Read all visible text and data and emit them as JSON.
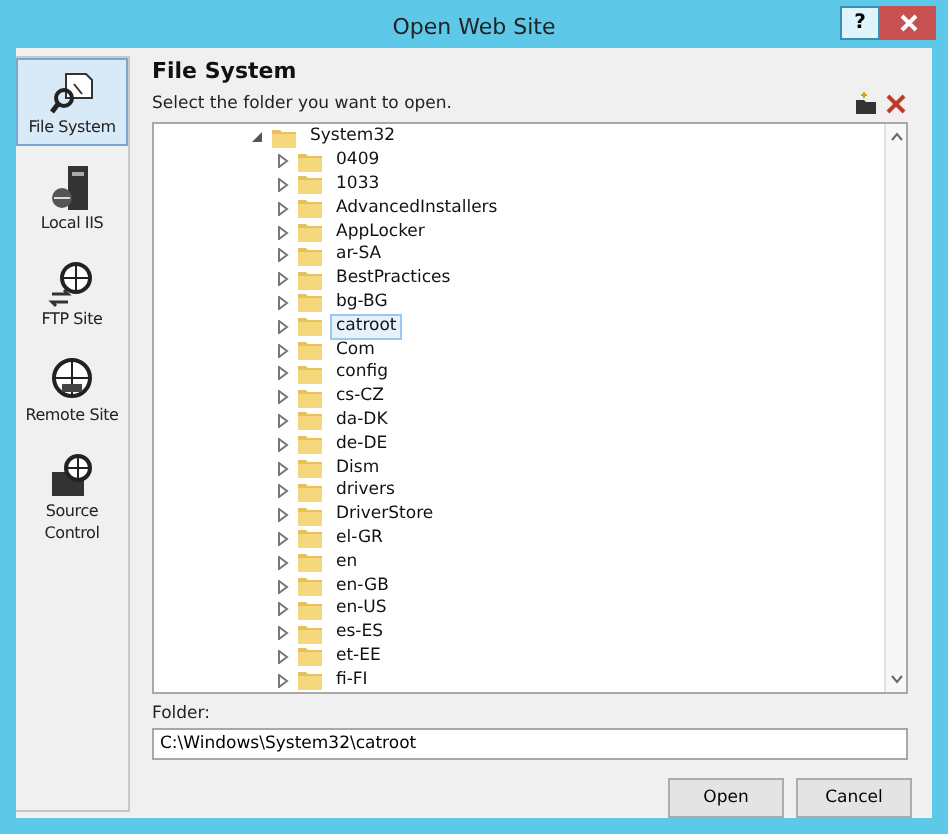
{
  "window": {
    "title": "Open Web Site",
    "help": "?"
  },
  "sidebar": {
    "items": [
      {
        "label": "File System",
        "kind": "filesystem",
        "selected": true
      },
      {
        "label": "Local IIS",
        "kind": "server",
        "selected": false
      },
      {
        "label": "FTP Site",
        "kind": "ftp",
        "selected": false
      },
      {
        "label": "Remote Site",
        "kind": "globe",
        "selected": false
      },
      {
        "label": "Source Control",
        "kind": "source",
        "selected": false
      }
    ]
  },
  "heading": "File System",
  "instruction": "Select the folder you want to open.",
  "tree": [
    {
      "label": "System32",
      "expanded": true,
      "selected": false,
      "children": [
        {
          "label": "0409",
          "expanded": false,
          "selected": false
        },
        {
          "label": "1033",
          "expanded": false,
          "selected": false
        },
        {
          "label": "AdvancedInstallers",
          "expanded": false,
          "selected": false
        },
        {
          "label": "AppLocker",
          "expanded": false,
          "selected": false
        },
        {
          "label": "ar-SA",
          "expanded": false,
          "selected": false
        },
        {
          "label": "BestPractices",
          "expanded": false,
          "selected": false
        },
        {
          "label": "bg-BG",
          "expanded": false,
          "selected": false
        },
        {
          "label": "catroot",
          "expanded": false,
          "selected": true
        },
        {
          "label": "Com",
          "expanded": false,
          "selected": false
        },
        {
          "label": "config",
          "expanded": false,
          "selected": false
        },
        {
          "label": "cs-CZ",
          "expanded": false,
          "selected": false
        },
        {
          "label": "da-DK",
          "expanded": false,
          "selected": false
        },
        {
          "label": "de-DE",
          "expanded": false,
          "selected": false
        },
        {
          "label": "Dism",
          "expanded": false,
          "selected": false
        },
        {
          "label": "drivers",
          "expanded": false,
          "selected": false
        },
        {
          "label": "DriverStore",
          "expanded": false,
          "selected": false
        },
        {
          "label": "el-GR",
          "expanded": false,
          "selected": false
        },
        {
          "label": "en",
          "expanded": false,
          "selected": false
        },
        {
          "label": "en-GB",
          "expanded": false,
          "selected": false
        },
        {
          "label": "en-US",
          "expanded": false,
          "selected": false
        },
        {
          "label": "es-ES",
          "expanded": false,
          "selected": false
        },
        {
          "label": "et-EE",
          "expanded": false,
          "selected": false
        },
        {
          "label": "fi-FI",
          "expanded": false,
          "selected": false
        }
      ]
    }
  ],
  "folder": {
    "label": "Folder:",
    "value": "C:\\Windows\\System32\\catroot"
  },
  "buttons": [
    "Open",
    "Cancel"
  ]
}
